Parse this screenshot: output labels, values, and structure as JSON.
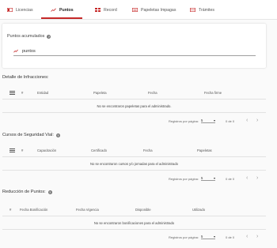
{
  "tabs": [
    {
      "label": "Licencias"
    },
    {
      "label": "Puntos"
    },
    {
      "label": "Record"
    },
    {
      "label": "Papeletas Impagas"
    },
    {
      "label": "Trámites"
    }
  ],
  "colors": {
    "accent": "#c62828",
    "active_tab_underline": "#c62828"
  },
  "points_card": {
    "title": "Puntos acumulados",
    "value": "puntos"
  },
  "infracciones": {
    "title": "Detalle de Infracciones:",
    "columns": [
      "#",
      "Entidad",
      "Papeleta",
      "Fecha",
      "Fecha firme"
    ],
    "empty": "No se encontraron papeletas para el administrado.",
    "paginator": {
      "label": "Registros por página:",
      "page_size": "5",
      "range": "0 de 0"
    }
  },
  "cursos": {
    "title": "Cursos de Seguridad Vial:",
    "columns": [
      "#",
      "Capacitación",
      "Certificado",
      "Fecha",
      "Papeletas"
    ],
    "empty": "No se encontraron cursos y/o jornadas para el administrado",
    "paginator": {
      "label": "Registros por página:",
      "page_size": "5",
      "range": "0 de 0"
    }
  },
  "reduccion": {
    "title": "Reducción de Puntos:",
    "columns": [
      "#",
      "Fecha Bonificación",
      "Fecha Vigencia",
      "Disponible",
      "Utilizado"
    ],
    "empty": "No se encontraron bonificaciones para el administrado",
    "paginator": {
      "label": "Registros por página:",
      "page_size": "5",
      "range": "0 de 0"
    }
  }
}
